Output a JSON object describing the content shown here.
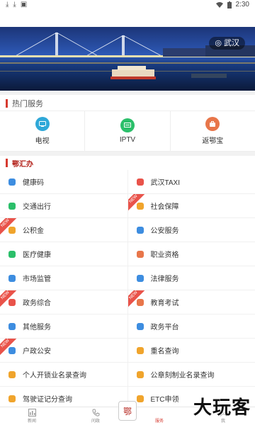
{
  "status_bar": {
    "time": "2:30",
    "left_icons": [
      "download-icon",
      "download-icon",
      "image-icon"
    ],
    "right_icons": [
      "wifi-icon",
      "battery-icon"
    ]
  },
  "banner": {
    "city": "武汉"
  },
  "hot_services": {
    "title": "热门服务",
    "items": [
      {
        "label": "电视",
        "icon": "tv-icon",
        "color": "#2fa8d8"
      },
      {
        "label": "IPTV",
        "icon": "iptv-icon",
        "color": "#2bbf6a"
      },
      {
        "label": "返鄂宝",
        "icon": "travel-icon",
        "color": "#e8764a"
      }
    ]
  },
  "ehuiban": {
    "title": "鄂汇办"
  },
  "services": [
    {
      "left": {
        "label": "健康码",
        "color": "#3d8de0",
        "new": false
      },
      "right": {
        "label": "武汉TAXI",
        "color": "#e9534a",
        "new": false
      }
    },
    {
      "left": {
        "label": "交通出行",
        "color": "#2bbf6a",
        "new": false
      },
      "right": {
        "label": "社会保障",
        "color": "#f0a42c",
        "new": true
      }
    },
    {
      "left": {
        "label": "公积金",
        "color": "#f0a42c",
        "new": true
      },
      "right": {
        "label": "公安服务",
        "color": "#3d8de0",
        "new": false
      }
    },
    {
      "left": {
        "label": "医疗健康",
        "color": "#2bbf6a",
        "new": false
      },
      "right": {
        "label": "职业资格",
        "color": "#e8764a",
        "new": false
      }
    },
    {
      "left": {
        "label": "市场监管",
        "color": "#3d8de0",
        "new": false
      },
      "right": {
        "label": "法律服务",
        "color": "#3d8de0",
        "new": false
      }
    },
    {
      "left": {
        "label": "政务综合",
        "color": "#e9534a",
        "new": true
      },
      "right": {
        "label": "教育考试",
        "color": "#e8764a",
        "new": true
      }
    },
    {
      "left": {
        "label": "其他服务",
        "color": "#3d8de0",
        "new": false
      },
      "right": {
        "label": "政务平台",
        "color": "#3d8de0",
        "new": false
      }
    },
    {
      "left": {
        "label": "户政公安",
        "color": "#3d8de0",
        "new": true
      },
      "right": {
        "label": "重名查询",
        "color": "#f0a42c",
        "new": false
      }
    },
    {
      "left": {
        "label": "个人开锁业名录查询",
        "color": "#f0a42c",
        "new": false
      },
      "right": {
        "label": "公章刻制业名录查询",
        "color": "#f0a42c",
        "new": false
      }
    },
    {
      "left": {
        "label": "驾驶证记分查询",
        "color": "#f0a42c",
        "new": false
      },
      "right": {
        "label": "ETC申领",
        "color": "#f0a42c",
        "new": false
      }
    }
  ],
  "new_tag": "NEW",
  "bottom_nav": [
    {
      "label": "新闻",
      "icon": "news-icon",
      "active": false
    },
    {
      "label": "问政",
      "icon": "phone-icon",
      "active": false
    },
    {
      "label": "服务",
      "icon": "service-icon",
      "active": true
    },
    {
      "label": "我",
      "icon": "user-icon",
      "active": false
    }
  ],
  "center_badge": "鄂",
  "watermark": "大玩客"
}
